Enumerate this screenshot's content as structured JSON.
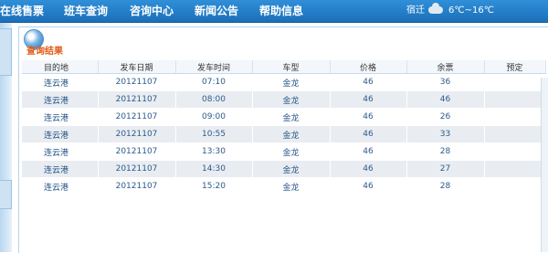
{
  "nav": {
    "items": [
      "在线售票",
      "班车查询",
      "咨询中心",
      "新闻公告",
      "帮助信息"
    ],
    "weather_city": "宿迁",
    "weather_icon": "cloud-icon",
    "weather_temp": "6℃~16℃"
  },
  "results": {
    "title": "查询结果",
    "columns": [
      "目的地",
      "发车日期",
      "发车时间",
      "车型",
      "价格",
      "余票",
      "预定"
    ],
    "rows": [
      {
        "dest": "连云港",
        "date": "20121107",
        "time": "07:10",
        "type": "金龙",
        "price": "46",
        "left": "36",
        "book": ""
      },
      {
        "dest": "连云港",
        "date": "20121107",
        "time": "08:00",
        "type": "金龙",
        "price": "46",
        "left": "46",
        "book": ""
      },
      {
        "dest": "连云港",
        "date": "20121107",
        "time": "09:00",
        "type": "金龙",
        "price": "46",
        "left": "26",
        "book": ""
      },
      {
        "dest": "连云港",
        "date": "20121107",
        "time": "10:55",
        "type": "金龙",
        "price": "46",
        "left": "33",
        "book": ""
      },
      {
        "dest": "连云港",
        "date": "20121107",
        "time": "13:30",
        "type": "金龙",
        "price": "46",
        "left": "28",
        "book": ""
      },
      {
        "dest": "连云港",
        "date": "20121107",
        "time": "14:30",
        "type": "金龙",
        "price": "46",
        "left": "27",
        "book": ""
      },
      {
        "dest": "连云港",
        "date": "20121107",
        "time": "15:20",
        "type": "金龙",
        "price": "46",
        "left": "28",
        "book": ""
      }
    ]
  },
  "colors": {
    "nav_bar": "#1c6fb9",
    "title_orange": "#e05a16",
    "row_alt": "#e9edf1",
    "cell_text": "#2c5a8d"
  }
}
